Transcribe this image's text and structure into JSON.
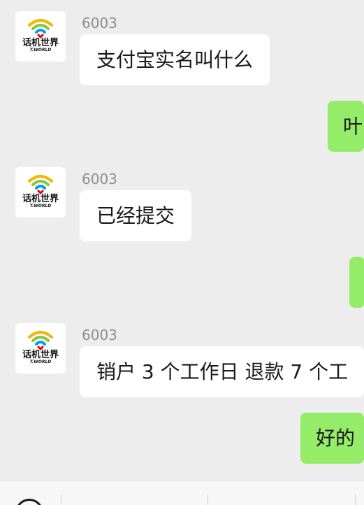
{
  "chat": {
    "messages": [
      {
        "direction": "in",
        "sender": "6003",
        "text": "支付宝实名叫什么"
      },
      {
        "direction": "out",
        "text": "叶"
      },
      {
        "direction": "in",
        "sender": "6003",
        "text": "已经提交"
      },
      {
        "direction": "out",
        "text": ""
      },
      {
        "direction": "in",
        "sender": "6003",
        "text": "销户 3 个工作日  退款 7 个工"
      },
      {
        "direction": "out",
        "text": "好的"
      }
    ],
    "avatar": {
      "logo_text": "话机世界",
      "logo_subtext": "T.WORLD"
    }
  },
  "bottom_bar": {
    "items": [
      "",
      "",
      ""
    ]
  },
  "colors": {
    "background": "#ededed",
    "incoming_bubble": "#ffffff",
    "outgoing_bubble": "#95ec69",
    "sender_name": "#8e8e8e"
  }
}
